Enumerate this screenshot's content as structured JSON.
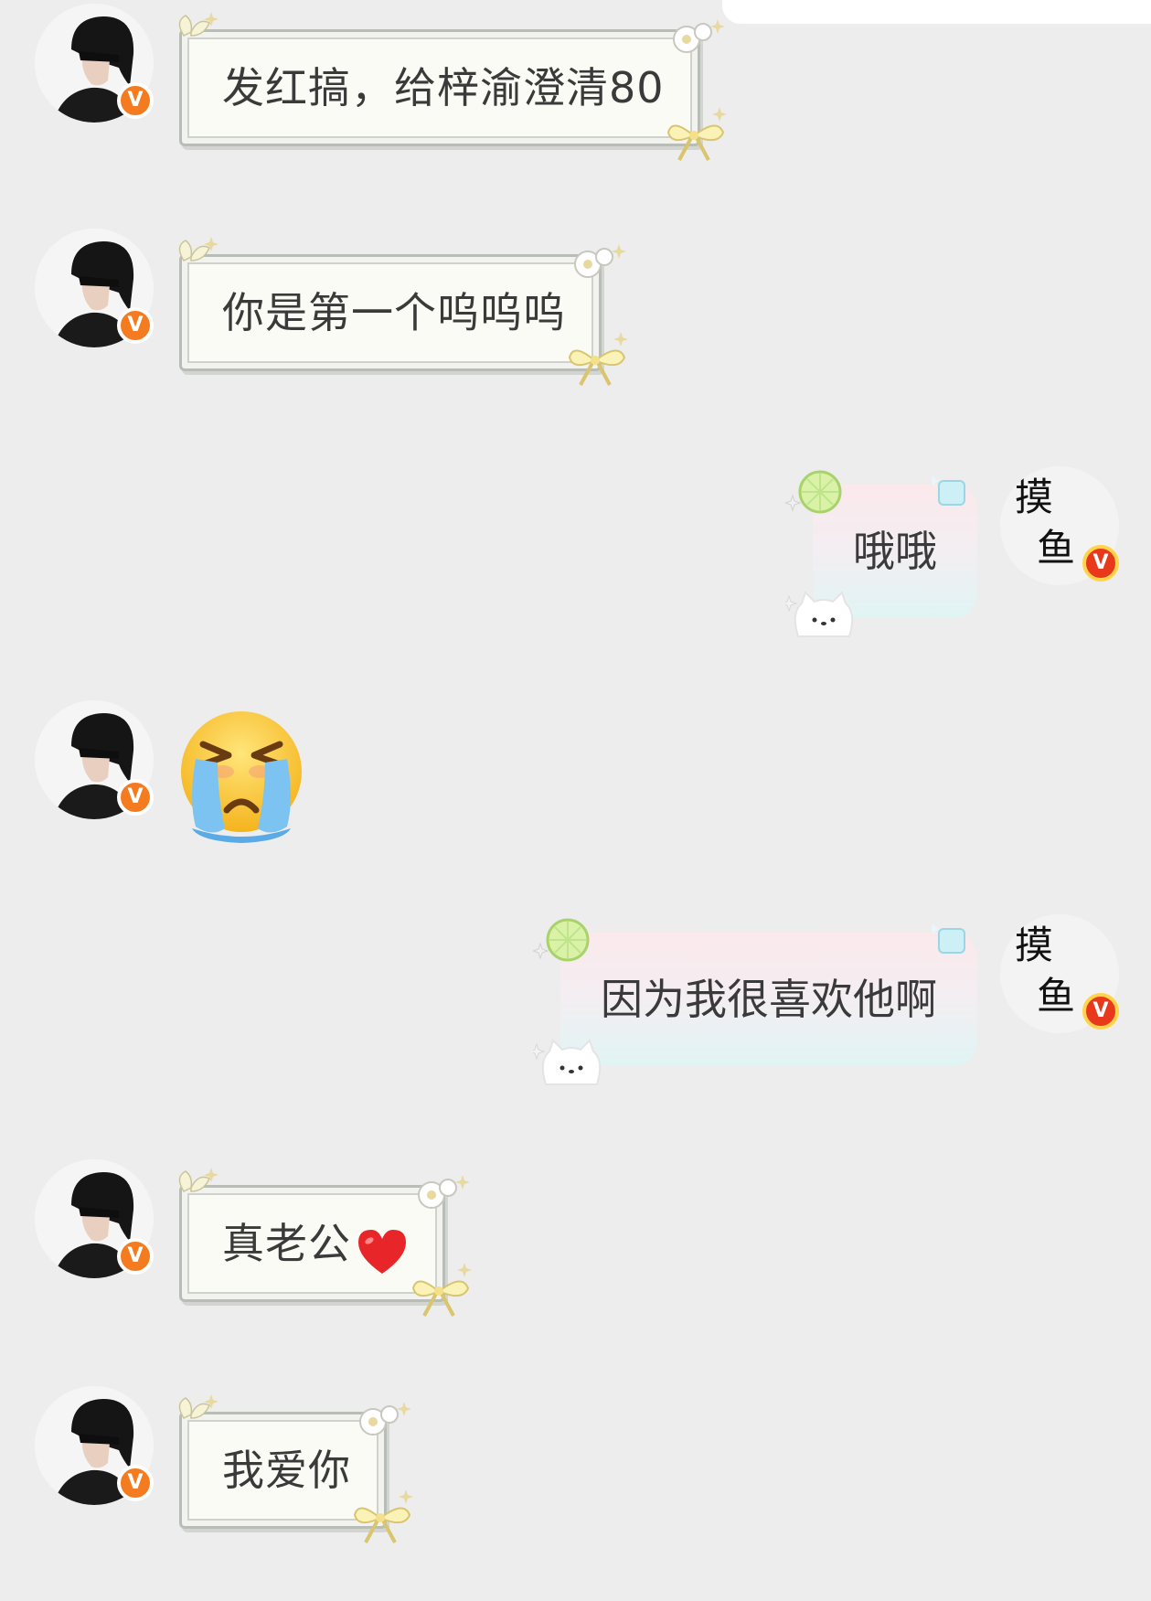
{
  "messages": [
    {
      "side": "left",
      "text": "发红搞，给梓渝澄清80"
    },
    {
      "side": "left",
      "text": "你是第一个呜呜呜"
    },
    {
      "side": "right",
      "text": "哦哦"
    },
    {
      "side": "left",
      "emoji": "crying-face"
    },
    {
      "side": "right",
      "text": "因为我很喜欢他啊"
    },
    {
      "side": "left",
      "text": "真老公",
      "emoji": "red-heart"
    },
    {
      "side": "left",
      "text": "我爱你"
    }
  ],
  "badges": {
    "verified": "V"
  },
  "right_avatar_glyph": "摸鱼",
  "colors": {
    "background": "#ededed",
    "badge_orange": "#f47b1f",
    "badge_red": "#e8391c",
    "badge_gold_ring": "#ffd34a",
    "text": "#3a3a3a"
  }
}
